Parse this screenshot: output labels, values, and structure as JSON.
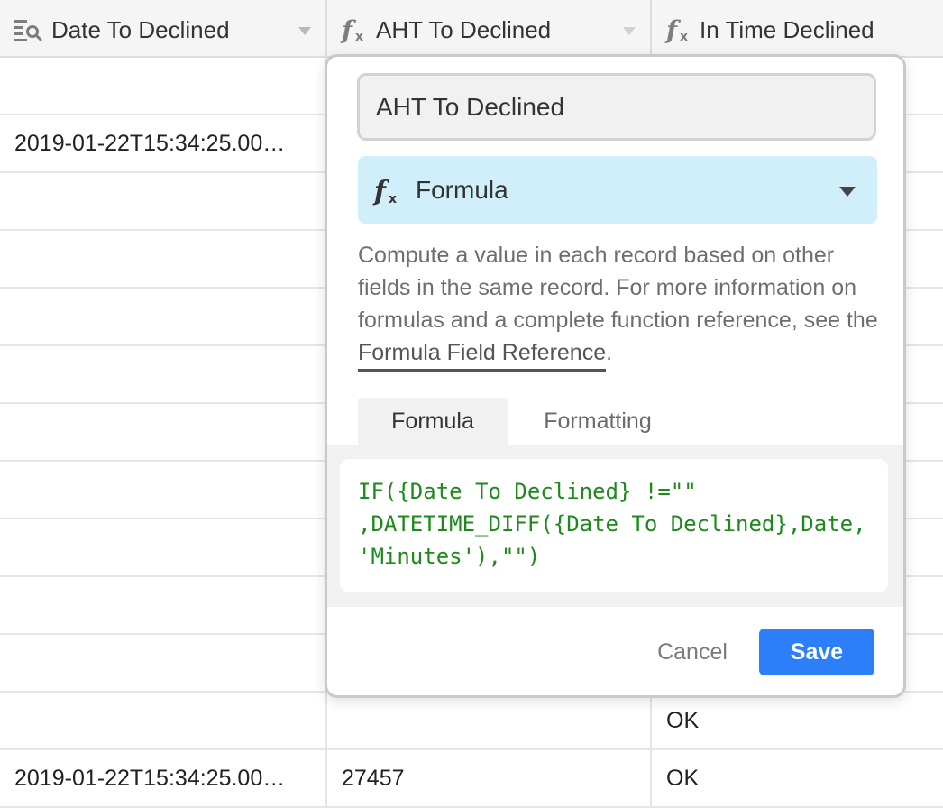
{
  "grid": {
    "columns": [
      {
        "label": "Date To Declined",
        "icon": "lookup-icon"
      },
      {
        "label": "AHT To Declined",
        "icon": "formula-icon"
      },
      {
        "label": "In Time Declined",
        "icon": "formula-icon"
      }
    ],
    "rows": [
      {
        "date": "",
        "aht": "",
        "status": ""
      },
      {
        "date": "2019-01-22T15:34:25.00…",
        "aht": "",
        "status": ""
      },
      {
        "date": "",
        "aht": "",
        "status": ""
      },
      {
        "date": "",
        "aht": "",
        "status": ""
      },
      {
        "date": "",
        "aht": "",
        "status": ""
      },
      {
        "date": "",
        "aht": "",
        "status": ""
      },
      {
        "date": "",
        "aht": "",
        "status": ""
      },
      {
        "date": "",
        "aht": "",
        "status": ""
      },
      {
        "date": "",
        "aht": "",
        "status": ""
      },
      {
        "date": "",
        "aht": "",
        "status": ""
      },
      {
        "date": "",
        "aht": "",
        "status": ""
      },
      {
        "date": "",
        "aht": "",
        "status": "OK"
      },
      {
        "date": "2019-01-22T15:34:25.00…",
        "aht": "27457",
        "status": "OK"
      }
    ]
  },
  "popup": {
    "field_name": "AHT To Declined",
    "field_type": "Formula",
    "description_prefix": "Compute a value in each record based on other fields in the same record. For more information on formulas and a complete function reference, see the ",
    "description_link": "Formula Field Reference",
    "description_suffix": ".",
    "tabs": {
      "formula": "Formula",
      "formatting": "Formatting"
    },
    "formula": "IF({Date To Declined} !=\"\" ,DATETIME_DIFF({Date To Declined},Date, 'Minutes'),\"\")",
    "cancel_label": "Cancel",
    "save_label": "Save"
  },
  "colors": {
    "accent": "#2d7ff9",
    "type_select_bg": "#d1eefb",
    "formula_text": "#1e8a1e"
  }
}
